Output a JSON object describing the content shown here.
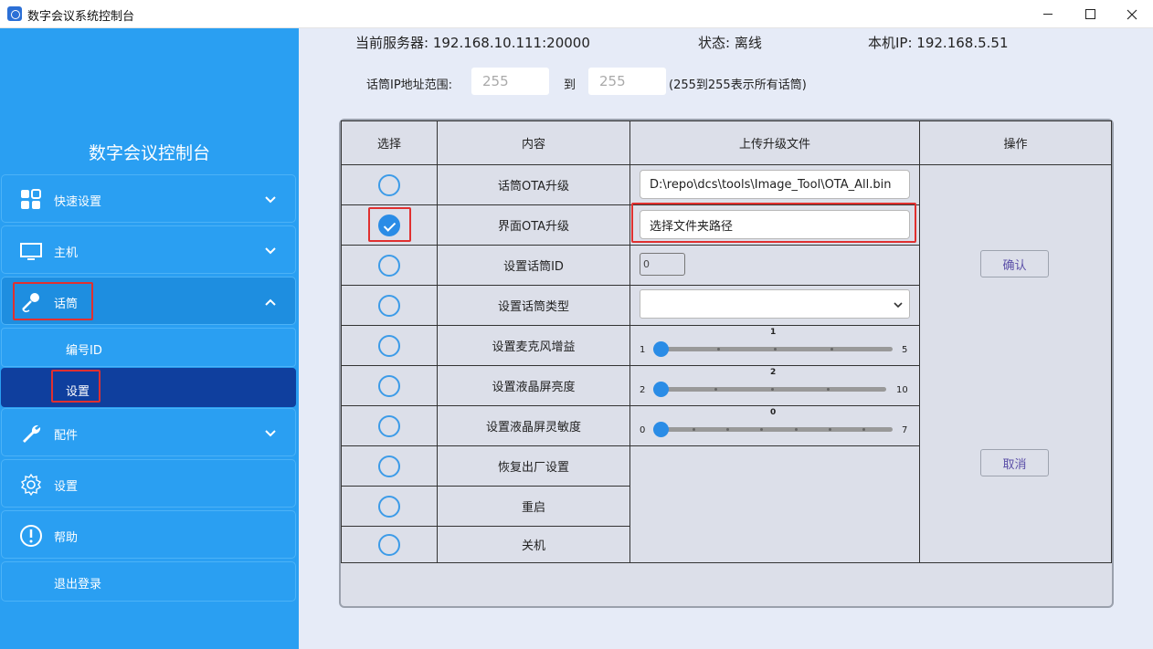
{
  "window": {
    "title": "数字会议系统控制台"
  },
  "sidebar": {
    "brand": "数字会议控制台",
    "items": [
      {
        "label": "快速设置",
        "icon": "grid-icon"
      },
      {
        "label": "主机",
        "icon": "monitor-icon"
      },
      {
        "label": "话筒",
        "icon": "microphone-icon"
      },
      {
        "label": "配件",
        "icon": "wrench-icon"
      },
      {
        "label": "设置",
        "icon": "gear-icon"
      },
      {
        "label": "帮助",
        "icon": "exclamation-icon"
      },
      {
        "label": "退出登录"
      }
    ],
    "sub_items": [
      {
        "label": "编号ID"
      },
      {
        "label": "设置"
      }
    ]
  },
  "header": {
    "server": "当前服务器: 192.168.10.111:20000",
    "status": "状态: 离线",
    "local_ip": "本机IP: 192.168.5.51",
    "range_label": "话筒IP地址范围:",
    "range_from": "255",
    "range_to_label": "到",
    "range_to": "255",
    "range_hint": "(255到255表示所有话筒)"
  },
  "table": {
    "columns": [
      "选择",
      "内容",
      "上传升级文件",
      "操作"
    ],
    "rows": [
      {
        "content": "话筒OTA升级",
        "checked": false
      },
      {
        "content": "界面OTA升级",
        "checked": true
      },
      {
        "content": "设置话筒ID",
        "checked": false
      },
      {
        "content": "设置话筒类型",
        "checked": false
      },
      {
        "content": "设置麦克风增益",
        "checked": false
      },
      {
        "content": "设置液晶屏亮度",
        "checked": false
      },
      {
        "content": "设置液晶屏灵敏度",
        "checked": false
      },
      {
        "content": "恢复出厂设置",
        "checked": false
      },
      {
        "content": "重启",
        "checked": false
      },
      {
        "content": "关机",
        "checked": false
      }
    ],
    "ota_file": "D:\\repo\\dcs\\tools\\Image_Tool\\OTA_All.bin",
    "ui_file_placeholder": "选择文件夹路径",
    "mic_id": "0",
    "gain": {
      "min": "1",
      "max": "5",
      "value": "1"
    },
    "brightness": {
      "min": "2",
      "max": "10",
      "value": "2"
    },
    "sensitivity": {
      "min": "0",
      "max": "7",
      "value": "0"
    },
    "confirm": "确认",
    "cancel": "取消"
  },
  "colors": {
    "sidebar": "#2a9ff2",
    "selected": "#0f3f9e",
    "highlight": "#e03030",
    "accent": "#2a8ce6"
  }
}
